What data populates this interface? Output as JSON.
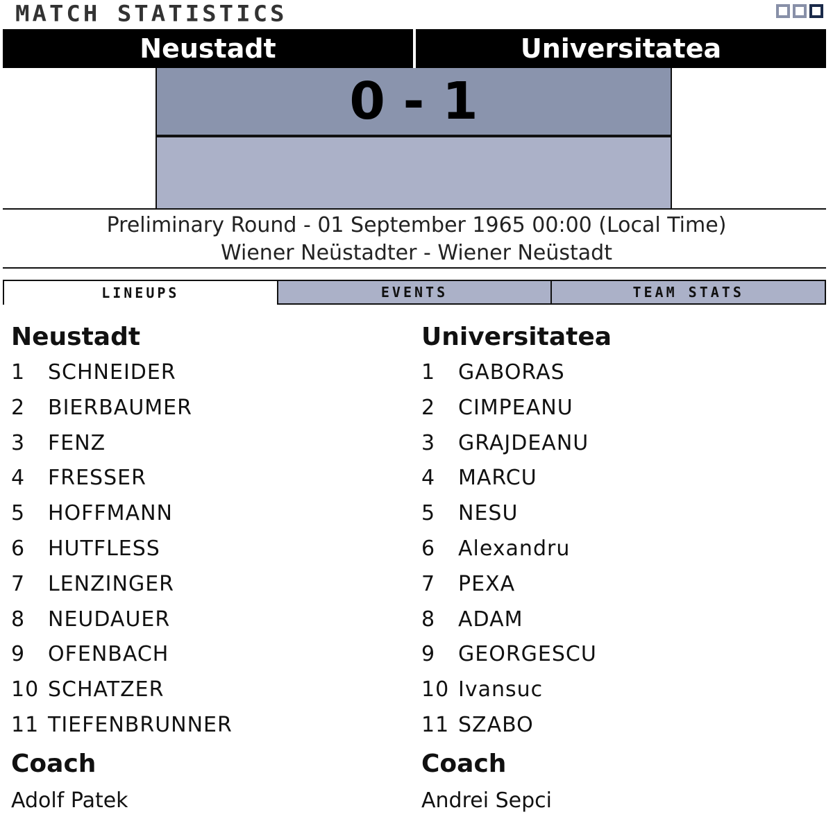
{
  "window": {
    "title": "MATCH STATISTICS",
    "buttons": [
      "minimize-icon",
      "restore-icon",
      "maximize-icon"
    ]
  },
  "match": {
    "home_team": "Neustadt",
    "away_team": "Universitatea",
    "score": "0 - 1",
    "info_line1": "Preliminary Round - 01 September 1965 00:00 (Local Time)",
    "info_line2": "Wiener Neüstadter - Wiener Neüstadt"
  },
  "tabs": [
    {
      "label": "LINEUPS",
      "active": true
    },
    {
      "label": "EVENTS",
      "active": false
    },
    {
      "label": "TEAM STATS",
      "active": false
    }
  ],
  "lineups": {
    "home": {
      "team": "Neustadt",
      "players": [
        {
          "num": "1",
          "name": "SCHNEIDER"
        },
        {
          "num": "2",
          "name": "BIERBAUMER"
        },
        {
          "num": "3",
          "name": "FENZ"
        },
        {
          "num": "4",
          "name": "FRESSER"
        },
        {
          "num": "5",
          "name": "HOFFMANN"
        },
        {
          "num": "6",
          "name": "HUTFLESS"
        },
        {
          "num": "7",
          "name": "LENZINGER"
        },
        {
          "num": "8",
          "name": "NEUDAUER"
        },
        {
          "num": "9",
          "name": "OFENBACH"
        },
        {
          "num": "10",
          "name": "SCHATZER"
        },
        {
          "num": "11",
          "name": "TIEFENBRUNNER"
        }
      ],
      "coach_label": "Coach",
      "coach": "Adolf Patek"
    },
    "away": {
      "team": "Universitatea",
      "players": [
        {
          "num": "1",
          "name": "GABORAS"
        },
        {
          "num": "2",
          "name": "CIMPEANU"
        },
        {
          "num": "3",
          "name": "GRAJDEANU"
        },
        {
          "num": "4",
          "name": "MARCU"
        },
        {
          "num": "5",
          "name": "NESU"
        },
        {
          "num": "6",
          "name": "Alexandru"
        },
        {
          "num": "7",
          "name": "PEXA"
        },
        {
          "num": "8",
          "name": "ADAM"
        },
        {
          "num": "9",
          "name": "GEORGESCU"
        },
        {
          "num": "10",
          "name": "Ivansuc"
        },
        {
          "num": "11",
          "name": "SZABO"
        }
      ],
      "coach_label": "Coach",
      "coach": "Andrei Sepci"
    }
  },
  "colors": {
    "score_bg": "#8a94ad",
    "panel_bg": "#abb1c8",
    "header_bg": "#000000"
  }
}
